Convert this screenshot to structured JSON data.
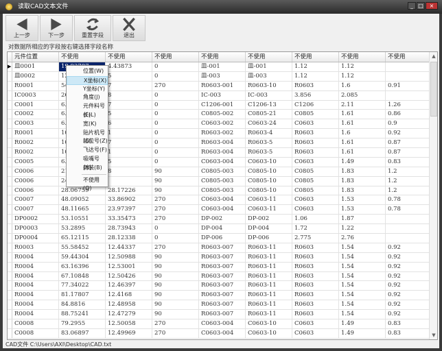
{
  "window": {
    "title": "读取CAD文本文件",
    "controls": [
      "_",
      "□",
      "×"
    ]
  },
  "toolbar": {
    "prev": "上一步",
    "next": "下一步",
    "reset": "重置字段",
    "exit": "退出"
  },
  "instruction": "对数据所相应的字段按右键选择字段名称",
  "grid": {
    "headers": [
      "元件位置",
      "不使用",
      "不使用",
      "不使用",
      "不使用",
      "不使用",
      "不使用",
      "不使用",
      "不使用"
    ],
    "current_row_marker": "▶",
    "selected_cell": "19.93787",
    "rows": [
      [
        "皿0001",
        "19.93787",
        "4.43873",
        "0",
        "皿-001",
        "皿-001",
        "1.12",
        "1.12",
        ""
      ],
      [
        "皿0002",
        "122.",
        "5",
        "0",
        "皿-003",
        "皿-003",
        "1.12",
        "1.12",
        ""
      ],
      [
        "R0001",
        "54.1",
        "7",
        "270",
        "R0603-001",
        "R0603-10",
        "R0603",
        "1.6",
        "0.91"
      ],
      [
        "IC0003",
        "26.6",
        "8",
        "0",
        "IC-003",
        "IC-003",
        "3.856",
        "2.085",
        ""
      ],
      [
        "C0001",
        "6.42",
        "7",
        "0",
        "C1206-001",
        "C1206-13",
        "C1206",
        "2.11",
        "1.26"
      ],
      [
        "C0002",
        "6.29",
        "5",
        "0",
        "C0805-002",
        "C0805-21",
        "C0805",
        "1.61",
        "0.86"
      ],
      [
        "C0003",
        "6.27",
        "6",
        "0",
        "C0603-002",
        "C0603-24",
        "C0603",
        "1.61",
        "0.9"
      ],
      [
        "R0001",
        "10.4",
        "1",
        "0",
        "R0603-002",
        "R0603-4",
        "R0603",
        "1.6",
        "0.92"
      ],
      [
        "R0002",
        "10.4",
        "7",
        "0",
        "R0603-004",
        "R0603-5",
        "R0603",
        "1.61",
        "0.87"
      ],
      [
        "R0002",
        "10.4",
        "1",
        "0",
        "R0603-004",
        "R0603-5",
        "R0603",
        "1.61",
        "0.87"
      ],
      [
        "C0005",
        "6.31",
        "5",
        "0",
        "C0603-004",
        "C0603-10",
        "C0603",
        "1.49",
        "0.83"
      ],
      [
        "C0006",
        "21.1",
        "8",
        "90",
        "C0805-003",
        "C0805-10",
        "C0805",
        "1.83",
        "1.2"
      ],
      [
        "C0006",
        "24.7",
        "",
        "90",
        "C0805-003",
        "C0805-10",
        "C0805",
        "1.83",
        "1.2"
      ],
      [
        "C0006",
        "28.06759",
        "28.17226",
        "90",
        "C0805-003",
        "C0805-10",
        "C0805",
        "1.83",
        "1.2"
      ],
      [
        "C0007",
        "48.09052",
        "33.86902",
        "270",
        "C0603-004",
        "C0603-11",
        "C0603",
        "1.53",
        "0.78"
      ],
      [
        "C0007",
        "48.11665",
        "23.97397",
        "270",
        "C0603-004",
        "C0603-11",
        "C0603",
        "1.53",
        "0.78"
      ],
      [
        "DP0002",
        "53.10551",
        "33.35473",
        "270",
        "DP-002",
        "DP-002",
        "1.06",
        "1.87",
        ""
      ],
      [
        "DP0003",
        "53.2895",
        "28.73943",
        "0",
        "DP-004",
        "DP-004",
        "1.72",
        "1.22",
        ""
      ],
      [
        "DP0004",
        "65.12115",
        "28.12338",
        "0",
        "DP-006",
        "DP-006",
        "2.775",
        "2.76",
        ""
      ],
      [
        "R0003",
        "55.58452",
        "12.44337",
        "270",
        "R0603-007",
        "R0603-11",
        "R0603",
        "1.54",
        "0.92"
      ],
      [
        "R0004",
        "59.44304",
        "12.50988",
        "90",
        "R0603-007",
        "R0603-11",
        "R0603",
        "1.54",
        "0.92"
      ],
      [
        "R0004",
        "63.16396",
        "12.53001",
        "90",
        "R0603-007",
        "R0603-11",
        "R0603",
        "1.54",
        "0.92"
      ],
      [
        "R0004",
        "67.10848",
        "12.50426",
        "90",
        "R0603-007",
        "R0603-11",
        "R0603",
        "1.54",
        "0.92"
      ],
      [
        "R0004",
        "77.34022",
        "12.46397",
        "90",
        "R0603-007",
        "R0603-11",
        "R0603",
        "1.54",
        "0.92"
      ],
      [
        "R0004",
        "81.17807",
        "12.4168",
        "90",
        "R0603-007",
        "R0603-11",
        "R0603",
        "1.54",
        "0.92"
      ],
      [
        "R0004",
        "84.8816",
        "12.48958",
        "90",
        "R0603-007",
        "R0603-11",
        "R0603",
        "1.54",
        "0.92"
      ],
      [
        "R0004",
        "88.75241",
        "12.47279",
        "90",
        "R0603-007",
        "R0603-11",
        "R0603",
        "1.54",
        "0.92"
      ],
      [
        "C0008",
        "79.2955",
        "12.50058",
        "270",
        "C0603-004",
        "C0603-10",
        "C0603",
        "1.49",
        "0.83"
      ],
      [
        "C0008",
        "83.06897",
        "12.49969",
        "270",
        "C0603-004",
        "C0603-10",
        "C0603",
        "1.49",
        "0.83"
      ]
    ]
  },
  "context_menu": {
    "items": [
      "位置(W)",
      "X坐标(X)",
      "Y坐标(Y)",
      "角度(J)",
      "元件料号(E)",
      "长(L)",
      "宽(K)",
      "贴片机号(G)",
      "站位号(Z)",
      "飞达号(F)",
      "吸嘴号(N)",
      "封装(B)",
      "不使用(Q)"
    ],
    "highlighted": "X坐标(X)"
  },
  "status": "CAD文件 C:\\Users\\AXI\\Desktop\\CAD.txt",
  "colors": {
    "selection": "#0a246a",
    "menu_highlight": "#cde8f6"
  }
}
